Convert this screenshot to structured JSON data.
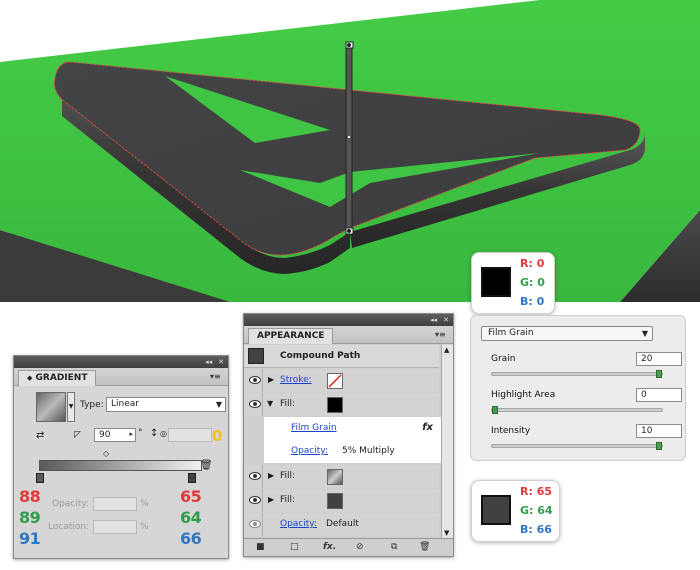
{
  "gradient_panel": {
    "title": "GRADIENT",
    "type_label": "Type:",
    "type_value": "Linear",
    "angle_value": "90",
    "aspect_value": "0",
    "opacity_label": "Opacity:",
    "location_label": "Location:",
    "percent_sign": "%",
    "degree_sign": "°",
    "left_stop": {
      "r": "88",
      "g": "89",
      "b": "91"
    },
    "right_stop": {
      "r": "65",
      "g": "64",
      "b": "66"
    }
  },
  "appearance_panel": {
    "title": "APPEARANCE",
    "object_label": "Compound Path",
    "stroke_label": "Stroke:",
    "fill_label": "Fill:",
    "effect_label": "Film Grain",
    "effect_icon": "fx",
    "opacity_label": "Opacity:",
    "fill_opacity_value": "5% Multiply",
    "fill2_label": "Fill:",
    "fill3_label": "Fill:",
    "object_opacity_label": "Opacity:",
    "object_opacity_value": "Default"
  },
  "color_black": {
    "r_label": "R:",
    "r": "0",
    "g_label": "G:",
    "g": "0",
    "b_label": "B:",
    "b": "0"
  },
  "color_dark": {
    "r_label": "R:",
    "r": "65",
    "g_label": "G:",
    "g": "64",
    "b_label": "B:",
    "b": "66"
  },
  "film_grain_panel": {
    "select_value": "Film Grain",
    "grain_label": "Grain",
    "grain_value": "20",
    "grain_level": 20,
    "grain_max": 20,
    "highlight_label": "Highlight Area",
    "highlight_value": "0",
    "highlight_level": 0,
    "highlight_max": 20,
    "intensity_label": "Intensity",
    "intensity_value": "10",
    "intensity_level": 10,
    "intensity_max": 10
  },
  "colors": {
    "green_surface": "#3ec142",
    "dark_base": "#3a3a3a",
    "letter_face": "#414042",
    "selection": "#ff3b3b",
    "red_text": "#e23a3a",
    "green_text": "#2f9d4a",
    "blue_text": "#2f77c0",
    "link_blue": "#1a46c4"
  }
}
